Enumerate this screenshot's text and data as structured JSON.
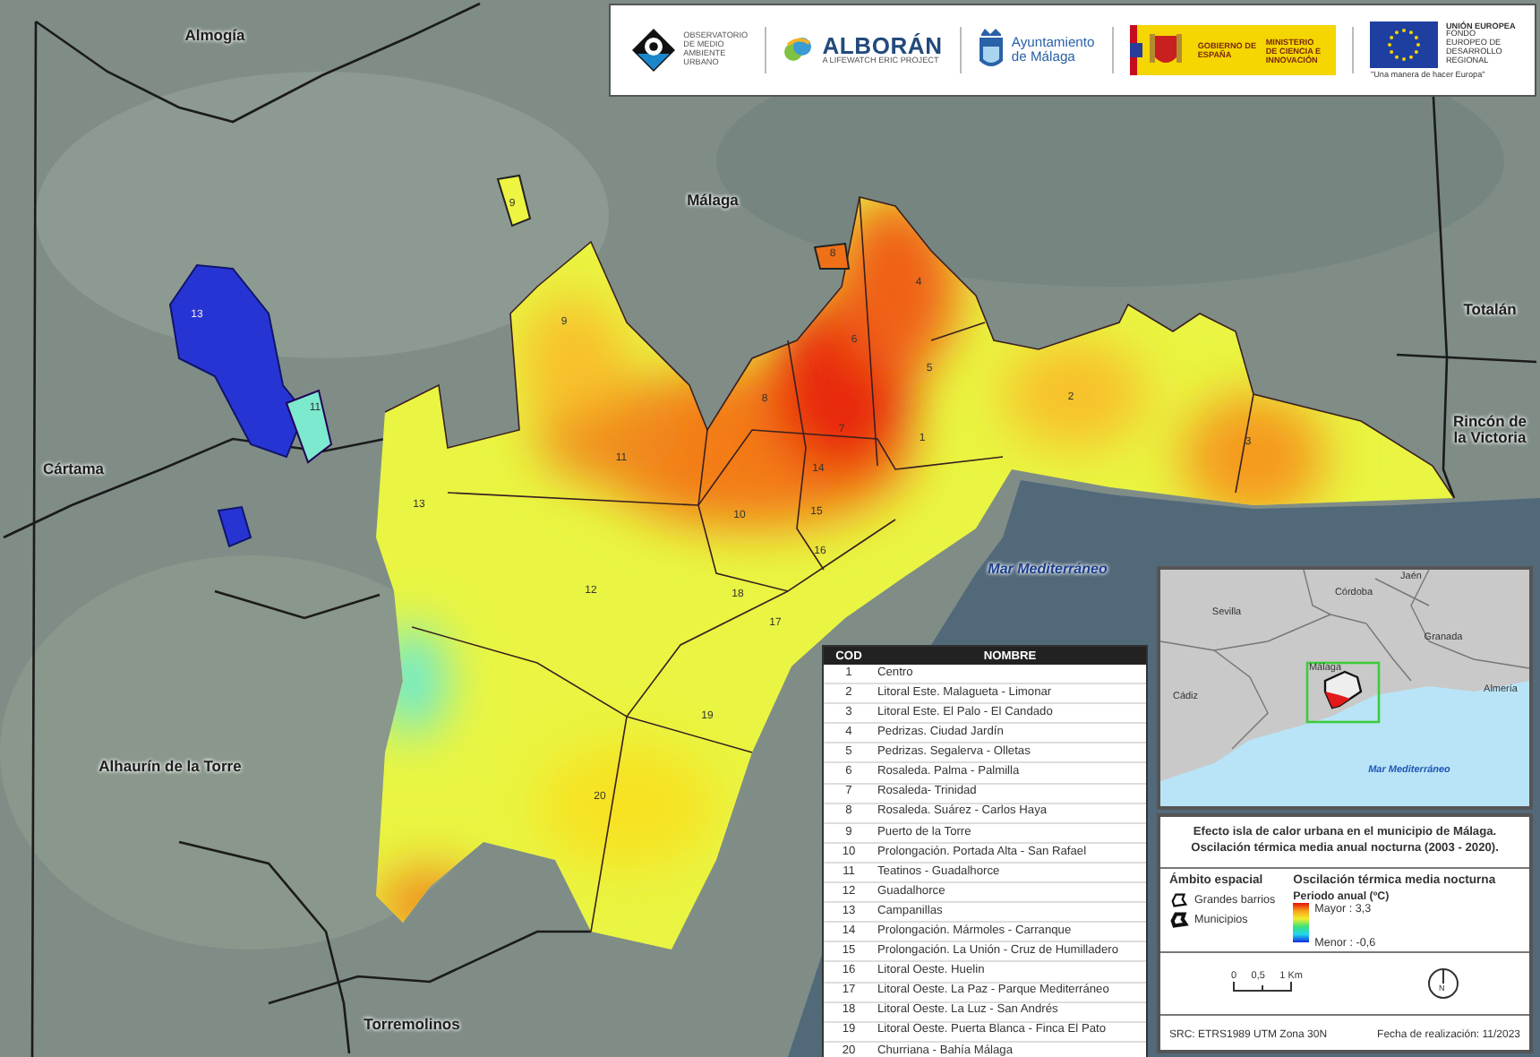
{
  "header_logos": [
    {
      "kind": "observatorio",
      "texts": [
        "OBSERVATORIO",
        "DE MEDIO",
        "AMBIENTE",
        "URBANO"
      ]
    },
    {
      "kind": "alboran",
      "texts": [
        "ALBORÁN",
        "A LIFEWATCH ERIC PROJECT"
      ]
    },
    {
      "kind": "ayuntamiento",
      "texts": [
        "Ayuntamiento",
        "de Málaga"
      ]
    },
    {
      "kind": "gobierno",
      "texts": [
        "GOBIERNO DE ESPAÑA",
        "MINISTERIO DE CIENCIA E INNOVACIÓN"
      ]
    },
    {
      "kind": "ue",
      "texts": [
        "UNIÓN EUROPEA",
        "FONDO EUROPEO DE DESARROLLO REGIONAL",
        "\"Una manera de hacer Europa\""
      ]
    }
  ],
  "map": {
    "place_labels": [
      "Almogía",
      "Málaga",
      "Totalán",
      "Rincón de la Victoria",
      "Cártama",
      "Alhaurín de la Torre",
      "Torremolinos"
    ],
    "sea_label": "Mar Mediterráneo",
    "district_labels": [
      "1",
      "2",
      "3",
      "4",
      "5",
      "6",
      "7",
      "8",
      "9",
      "10",
      "11",
      "12",
      "13",
      "14",
      "15",
      "16",
      "17",
      "18",
      "19",
      "20",
      "9",
      "8",
      "13",
      "11"
    ]
  },
  "table": {
    "columns": [
      "COD",
      "NOMBRE"
    ],
    "rows": [
      [
        "1",
        "Centro"
      ],
      [
        "2",
        "Litoral Este. Malagueta - Limonar"
      ],
      [
        "3",
        "Litoral Este. El Palo - El Candado"
      ],
      [
        "4",
        "Pedrizas. Ciudad Jardín"
      ],
      [
        "5",
        "Pedrizas. Segalerva - Olletas"
      ],
      [
        "6",
        "Rosaleda. Palma - Palmilla"
      ],
      [
        "7",
        "Rosaleda- Trinidad"
      ],
      [
        "8",
        "Rosaleda. Suárez - Carlos Haya"
      ],
      [
        "9",
        "Puerto de la Torre"
      ],
      [
        "10",
        "Prolongación. Portada Alta - San Rafael"
      ],
      [
        "11",
        "Teatinos - Guadalhorce"
      ],
      [
        "12",
        "Guadalhorce"
      ],
      [
        "13",
        "Campanillas"
      ],
      [
        "14",
        "Prolongación. Mármoles - Carranque"
      ],
      [
        "15",
        "Prolongación. La Unión - Cruz de Humilladero"
      ],
      [
        "16",
        "Litoral Oeste. Huelin"
      ],
      [
        "17",
        "Litoral Oeste. La Paz - Parque Mediterráneo"
      ],
      [
        "18",
        "Litoral Oeste. La Luz - San Andrés"
      ],
      [
        "19",
        "Litoral Oeste. Puerta Blanca - Finca El Pato"
      ],
      [
        "20",
        "Churriana - Bahía Málaga"
      ]
    ]
  },
  "locator_map": {
    "labels": [
      "Sevilla",
      "Córdoba",
      "Jaén",
      "Granada",
      "Cádiz",
      "Málaga",
      "Almería"
    ],
    "sea_label": "Mar Mediterráneo"
  },
  "legend": {
    "title_lines": [
      "Efecto isla de calor urbana en el municipio de Málaga.",
      "Oscilación térmica media anual nocturna (2003 - 2020)."
    ],
    "scope": {
      "heading": "Ámbito espacial",
      "items": [
        {
          "kind": "district",
          "label": "Grandes barrios"
        },
        {
          "kind": "municipality",
          "label": "Municipios"
        }
      ]
    },
    "variable": {
      "heading": "Oscilación térmica media nocturna",
      "period": "Periodo anual (ºC)",
      "max_label": "Mayor : 3,3",
      "min_label": "Menor : -0,6"
    },
    "scale_ticks": [
      "0",
      "0,5",
      "1 Km"
    ],
    "north": "N",
    "crs": "SRC: ETRS1989 UTM Zona 30N",
    "date": "Fecha de realización: 11/2023"
  }
}
